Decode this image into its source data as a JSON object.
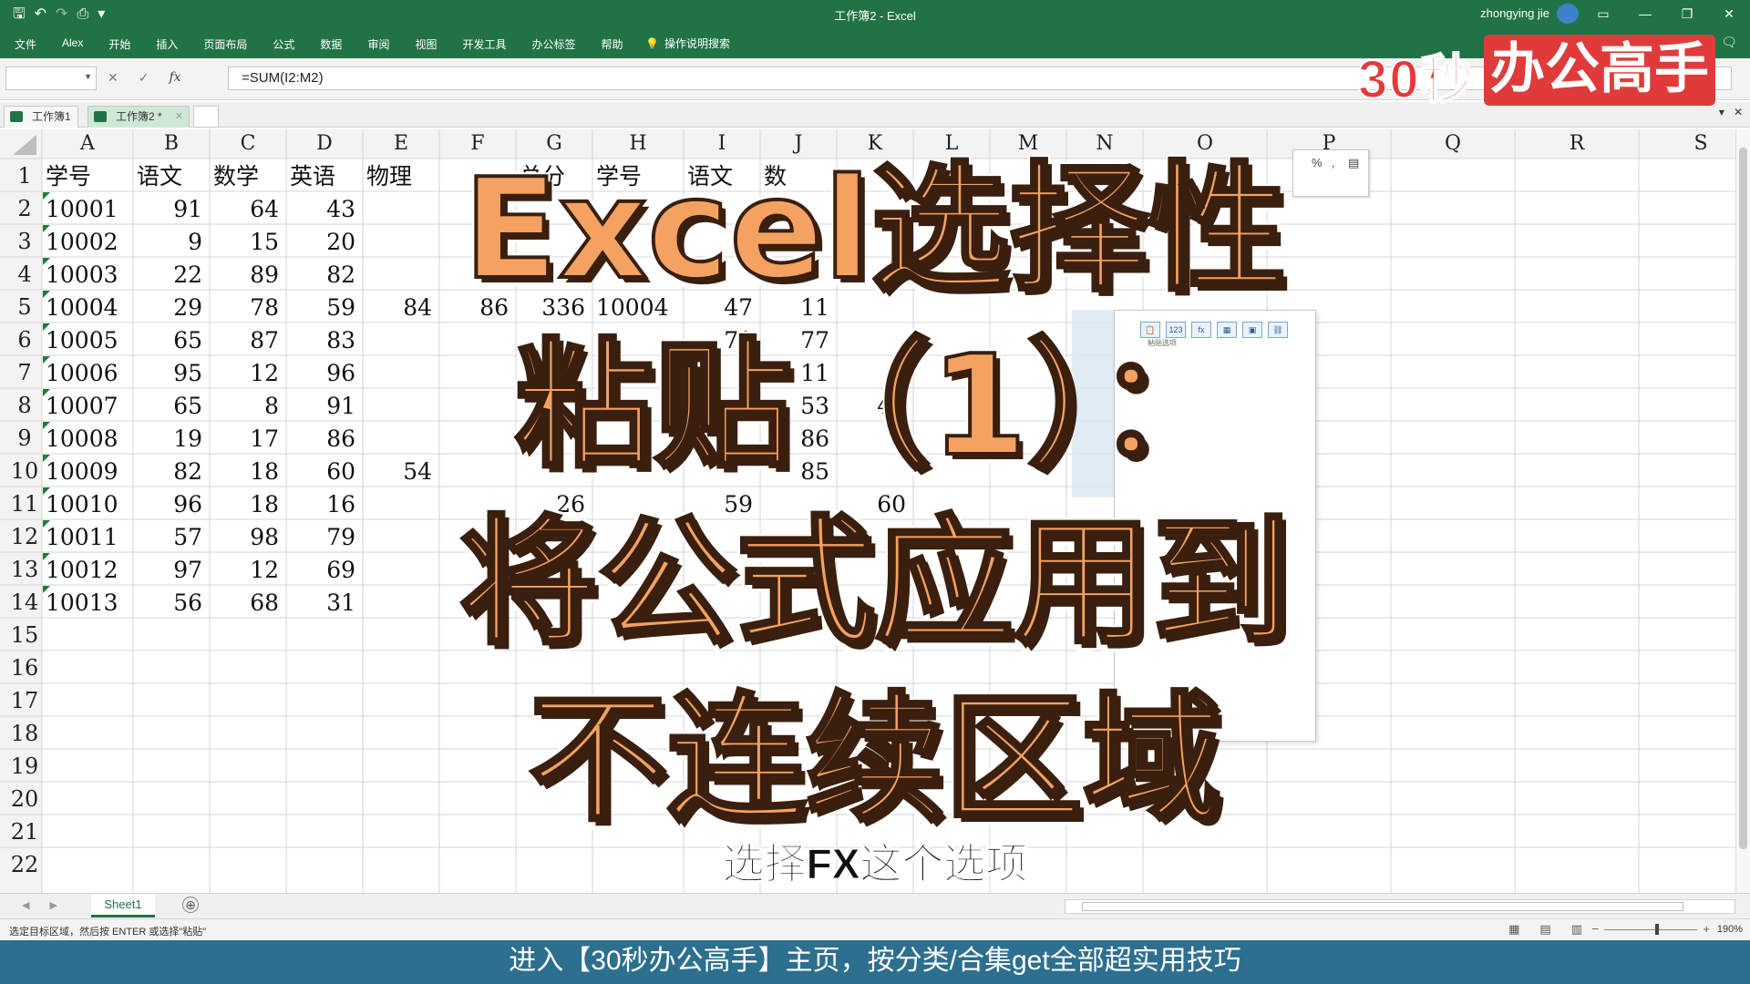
{
  "titlebar": {
    "window_title": "工作簿2  -  Excel",
    "user": "zhongying jie",
    "qat": {
      "save_icon": "save-icon",
      "undo_icon": "undo-icon",
      "redo_icon": "redo-icon",
      "preview_icon": "print-preview-icon"
    },
    "window_controls": {
      "ribbon_display": "▭",
      "minimize": "—",
      "restore": "❐",
      "close": "✕"
    }
  },
  "ribbon": {
    "tabs": [
      "文件",
      "Alex",
      "开始",
      "插入",
      "页面布局",
      "公式",
      "数据",
      "审阅",
      "视图",
      "开发工具",
      "办公标签",
      "帮助"
    ],
    "search_label": "操作说明搜索",
    "comment_icon": "comment-icon"
  },
  "formula_bar": {
    "name_box": "",
    "cancel": "✕",
    "enter": "✓",
    "fx": "fx",
    "formula": "=SUM(I2:M2)"
  },
  "workbook_tabs": [
    {
      "label": "工作簿1",
      "active": false
    },
    {
      "label": "工作簿2 *",
      "active": true
    }
  ],
  "grid": {
    "columns": [
      "A",
      "B",
      "C",
      "D",
      "E",
      "F",
      "G",
      "H",
      "I",
      "J",
      "K",
      "L",
      "M",
      "N",
      "O",
      "P",
      "Q",
      "R",
      "S"
    ],
    "rows": [
      "1",
      "2",
      "3",
      "4",
      "5",
      "6",
      "7",
      "8",
      "9",
      "10",
      "11",
      "12",
      "13",
      "14",
      "15",
      "16",
      "17",
      "18",
      "19",
      "20",
      "21",
      "22"
    ],
    "header_row": [
      "学号",
      "语文",
      "数学",
      "英语",
      "物理",
      "",
      "总分",
      "学号",
      "语文",
      "数"
    ],
    "data": [
      [
        "10001",
        "91",
        "64",
        "43"
      ],
      [
        "10002",
        "9",
        "15",
        "20"
      ],
      [
        "10003",
        "22",
        "89",
        "82"
      ],
      [
        "10004",
        "29",
        "78",
        "59"
      ],
      [
        "10005",
        "65",
        "87",
        "83"
      ],
      [
        "10006",
        "95",
        "12",
        "96"
      ],
      [
        "10007",
        "65",
        "8",
        "91"
      ],
      [
        "10008",
        "19",
        "17",
        "86"
      ],
      [
        "10009",
        "82",
        "18",
        "60"
      ],
      [
        "10010",
        "96",
        "18",
        "16"
      ],
      [
        "10011",
        "57",
        "98",
        "79"
      ],
      [
        "10012",
        "97",
        "12",
        "69"
      ],
      [
        "10013",
        "56",
        "68",
        "31"
      ]
    ],
    "partial_cells": [
      {
        "col": 4,
        "row": 5,
        "text": "84"
      },
      {
        "col": 5,
        "row": 5,
        "text": "86"
      },
      {
        "col": 6,
        "row": 5,
        "text": "336"
      },
      {
        "col": 7,
        "row": 5,
        "text": "10004"
      },
      {
        "col": 8,
        "row": 5,
        "text": "47"
      },
      {
        "col": 9,
        "row": 5,
        "text": "11"
      },
      {
        "col": 8,
        "row": 6,
        "text": "71"
      },
      {
        "col": 9,
        "row": 6,
        "text": "77"
      },
      {
        "col": 9,
        "row": 7,
        "text": "11"
      },
      {
        "col": 9,
        "row": 8,
        "text": "53"
      },
      {
        "col": 10,
        "row": 8,
        "text": "46"
      },
      {
        "col": 9,
        "row": 9,
        "text": "86"
      },
      {
        "col": 4,
        "row": 10,
        "text": "54"
      },
      {
        "col": 9,
        "row": 10,
        "text": "85"
      },
      {
        "col": 6,
        "row": 11,
        "text": "26"
      },
      {
        "col": 8,
        "row": 11,
        "text": "59"
      },
      {
        "col": 10,
        "row": 11,
        "text": "60"
      }
    ]
  },
  "mini_toolbar": {
    "percent": "%",
    "comma": ",",
    "format_icon": "format-icon"
  },
  "paste_panel": {
    "hint": "粘贴选项"
  },
  "sheet_bar": {
    "sheet": "Sheet1",
    "add_icon": "⊕"
  },
  "status_bar": {
    "message": "选定目标区域，然后按 ENTER 或选择\"粘贴\"",
    "zoom": "190%",
    "zoom_minus": "−",
    "zoom_plus": "+"
  },
  "overlay": {
    "brand_seconds": "30秒",
    "brand_name": "办公高手",
    "headline_lines": [
      "Excel选择性",
      "粘贴（1）：",
      "将公式应用到",
      "不连续区域"
    ],
    "subtitle": "选择FX这个选项",
    "footer": "进入【30秒办公高手】主页，按分类/合集get全部超实用技巧"
  },
  "colors": {
    "excel_green": "#217346",
    "brand_red": "#e03b3b",
    "headline_orange": "#f4a261",
    "footer_blue": "#2c6f8f"
  }
}
